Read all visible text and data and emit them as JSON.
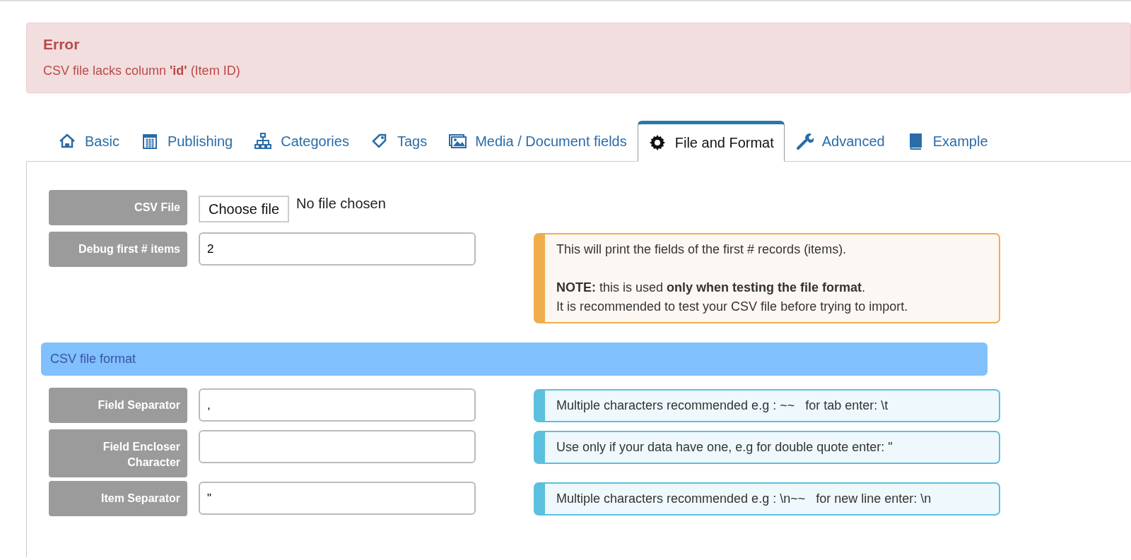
{
  "alert": {
    "title": "Error",
    "message": "CSV file lacks column **'id'** (Item ID)"
  },
  "tabs": [
    {
      "label": "Basic",
      "selected": false
    },
    {
      "label": "Publishing",
      "selected": false
    },
    {
      "label": "Categories",
      "selected": false
    },
    {
      "label": "Tags",
      "selected": false
    },
    {
      "label": "Media / Document fields",
      "selected": false
    },
    {
      "label": "File and Format",
      "selected": true
    },
    {
      "label": "Advanced",
      "selected": false
    },
    {
      "label": "Example",
      "selected": false
    }
  ],
  "sections": [
    {
      "rows": [
        {
          "kind": "file",
          "label": "CSV File",
          "button": "Choose file",
          "status": "No file chosen"
        },
        {
          "kind": "text",
          "label": "Debug first # items",
          "value": "2",
          "note": {
            "kind": "warning",
            "paragraphs": [
              [
                "This will print the fields of the first # records (items)."
              ],
              [
                "**NOTE:** this is used **only when testing the file format**.",
                "It is recommended to test your CSV file before trying to import."
              ]
            ]
          }
        }
      ]
    },
    {
      "heading": "CSV file format",
      "rows": [
        {
          "kind": "text",
          "label": "Field Separator",
          "value": ",",
          "note": {
            "kind": "info",
            "paragraphs": [
              [
                "Multiple characters recommended e.g : ~~   for tab enter: \\t"
              ]
            ]
          }
        },
        {
          "kind": "text",
          "label": "Field Encloser Character",
          "note": {
            "kind": "info",
            "paragraphs": [
              [
                "Use only if your data have one, e.g for double quote enter: \""
              ]
            ]
          }
        },
        {
          "kind": "text",
          "label": "Item Separator",
          "value": "\"",
          "note": {
            "kind": "info",
            "paragraphs": [
              [
                "Multiple characters recommended e.g : \\n~~   for new line enter: \\n"
              ]
            ]
          }
        }
      ]
    }
  ]
}
